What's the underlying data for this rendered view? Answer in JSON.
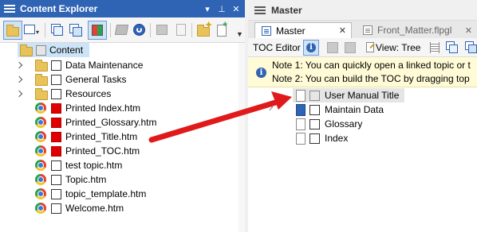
{
  "left_panel": {
    "title": "Content Explorer",
    "title_buttons": [
      "▾",
      "⊥",
      "✕"
    ],
    "root": {
      "label": "Content"
    },
    "folders": [
      {
        "label": "Data Maintenance"
      },
      {
        "label": "General Tasks"
      },
      {
        "label": "Resources"
      }
    ],
    "files": [
      {
        "label": "Printed Index.htm",
        "flag": "red"
      },
      {
        "label": "Printed_Glossary.htm",
        "flag": "red"
      },
      {
        "label": "Printed_Title.htm",
        "flag": "red"
      },
      {
        "label": "Printed_TOC.htm",
        "flag": "red"
      },
      {
        "label": "test topic.htm",
        "flag": "none"
      },
      {
        "label": "Topic.htm",
        "flag": "none"
      },
      {
        "label": "topic_template.htm",
        "flag": "none"
      },
      {
        "label": "Welcome.htm",
        "flag": "none"
      }
    ]
  },
  "right_panel": {
    "title": "Master",
    "tabs": [
      {
        "label": "Master",
        "close": "✕",
        "active": true
      },
      {
        "label": "Front_Matter.flpgl",
        "close": "✕",
        "active": false
      }
    ],
    "toolbar": {
      "label": "TOC Editor",
      "info_glyph": "i",
      "view_label": "View: Tree"
    },
    "notes": [
      "Note 1: You can quickly open a linked topic or t",
      "Note 2: You can build the TOC by dragging top"
    ],
    "toc_items": [
      {
        "label": "User Manual Title",
        "selected": true
      },
      {
        "label": "Maintain Data"
      },
      {
        "label": "Glossary"
      },
      {
        "label": "Index"
      }
    ]
  },
  "colors": {
    "accent": "#2f63b4",
    "arrow": "#e01a1a",
    "flag_red": "#e10000",
    "note_bg": "#fffbd6"
  }
}
